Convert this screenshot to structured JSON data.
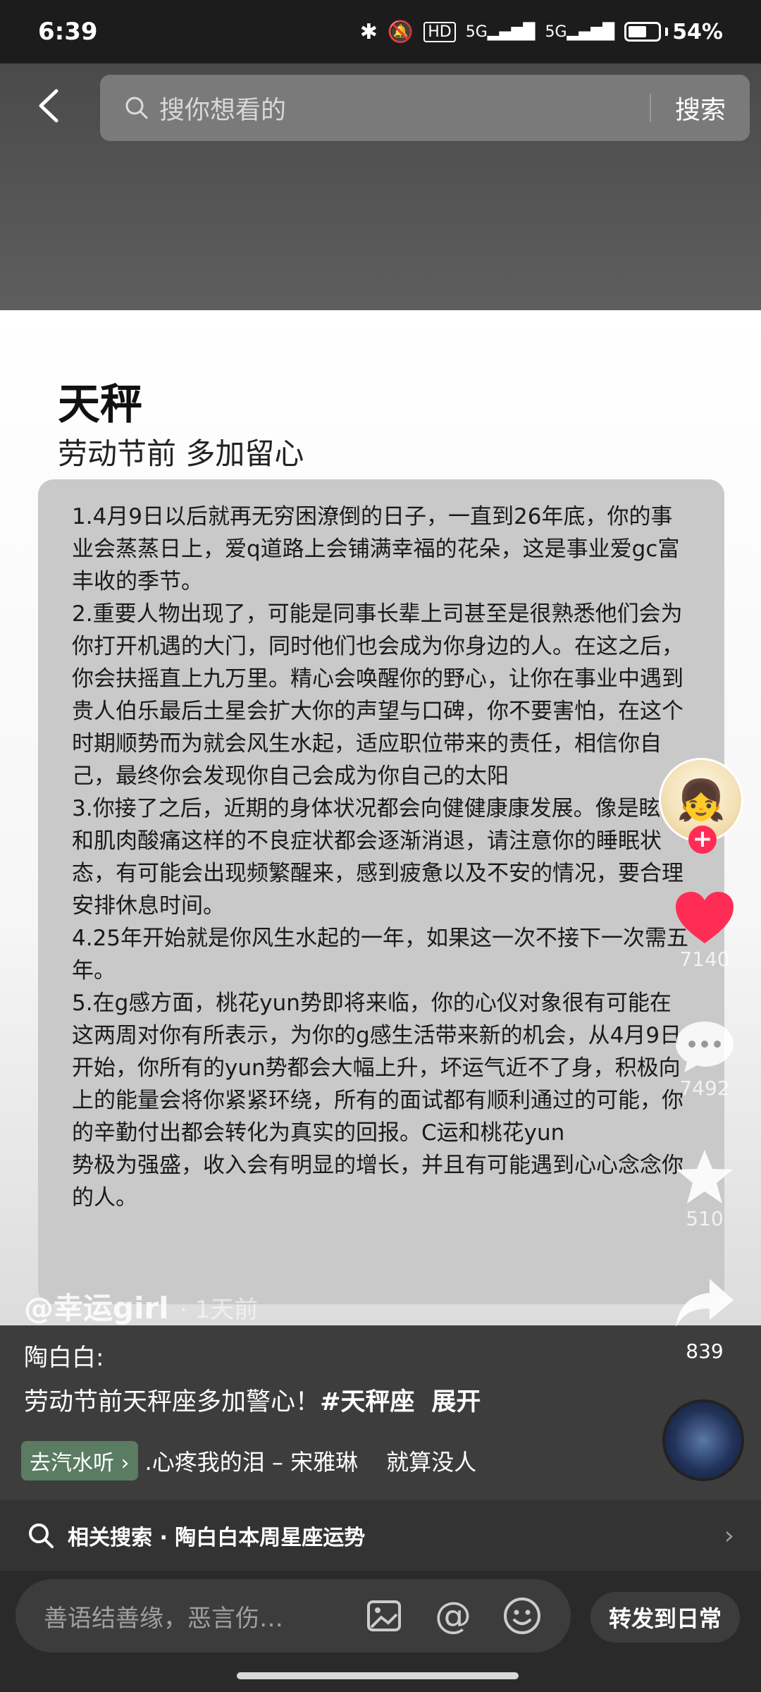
{
  "status": {
    "time": "6:39",
    "battery": "54%",
    "network": "5G"
  },
  "search": {
    "placeholder": "搜你想看的",
    "button": "搜索"
  },
  "card": {
    "title": "天秤",
    "subtitle": "劳动节前 多加留心",
    "paragraphs": [
      "1.4月9日以后就再无穷困潦倒的日子，一直到26年底，你的事业会蒸蒸日上，爱q道路上会铺满幸福的花朵，这是事业爱gc富丰收的季节。",
      "2.重要人物出现了，可能是同事长辈上司甚至是很熟悉他们会为你打开机遇的大门，同时他们也会成为你身边的人。在这之后，你会扶摇直上九万里。精心会唤醒你的野心，让你在事业中遇到贵人伯乐最后土星会扩大你的声望与口碑，你不要害怕，在这个时期顺势而为就会风生水起，适应职位带来的责任，相信你自己，最终你会发现你自己会成为你自己的太阳",
      "3.你接了之后，近期的身体状况都会向健健康康发展。像是眩晕和肌肉酸痛这样的不良症状都会逐渐消退，请注意你的睡眠状态，有可能会出现频繁醒来，感到疲惫以及不安的情况，要合理安排休息时间。",
      "4.25年开始就是你风生水起的一年，如果这一次不接下一次需五年。",
      "5.在g感方面，桃花yun势即将来临，你的心仪对象很有可能在这两周对你有所表示，为你的g感生活带来新的机会，从4月9日开始，你所有的yun势都会大幅上升，坏运气近不了身，积极向上的能量会将你紧紧环绕，所有的面试都有顺利通过的可能，你的辛勤付出都会转化为真实的回报。C运和桃花yun\n势极为强盛，收入会有明显的增长，并且有可能遇到心心念念你的人。"
    ]
  },
  "overlay": {
    "author": "@幸运girl",
    "time": "· 1天前"
  },
  "actions": {
    "likes": "7140",
    "comments": "7492",
    "favorites": "510",
    "shares": "839"
  },
  "caption": {
    "author": "陶白白:",
    "text": "劳动节前天秤座多加警心！",
    "hashtag": "#天秤座",
    "expand": "展开"
  },
  "music": {
    "tag": "去汽水听 ›",
    "title": ".心疼我的泪 – 宋雅琳",
    "extra": "就算没人"
  },
  "related": {
    "label": "相关搜索 · 陶白白本周星座运势"
  },
  "comment": {
    "placeholder": "善语结善缘，恶言伤…",
    "share_button": "转发到日常"
  }
}
